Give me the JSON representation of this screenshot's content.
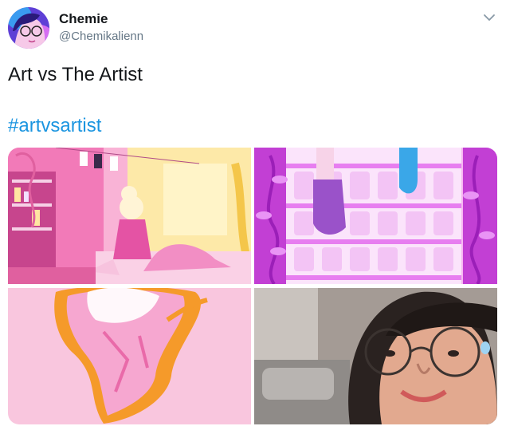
{
  "author": {
    "display_name": "Chemie",
    "handle": "@Chemikalienn"
  },
  "tweet": {
    "text": "Art vs The Artist",
    "hashtag": "#artvsartist"
  },
  "icons": {
    "menu": "chevron-down-icon"
  },
  "colors": {
    "hashtag": "#1b95e0",
    "handle": "#657786",
    "text": "#14171a"
  }
}
